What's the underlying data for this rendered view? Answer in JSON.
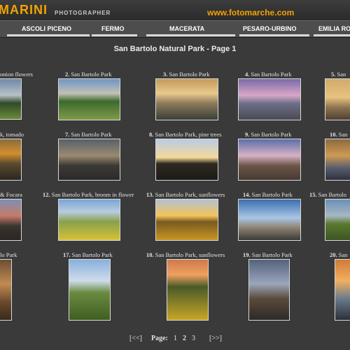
{
  "header": {
    "brand": "MARINI",
    "subtitle": "PHOTOGRAPHER",
    "site_url": "www.fotomarche.com"
  },
  "nav": [
    "ASCOLI PICENO",
    "FERMO",
    "MACERATA",
    "PESARO-URBINO",
    "EMILIA RO"
  ],
  "page_title": "San Bartolo Natural Park - Page 1",
  "gallery": [
    {
      "num": "",
      "label": "onion flowers"
    },
    {
      "num": "2.",
      "label": "San Bartolo Park"
    },
    {
      "num": "3.",
      "label": "San Bartolo Park"
    },
    {
      "num": "4.",
      "label": "San Bartolo Park"
    },
    {
      "num": "5.",
      "label": "San"
    },
    {
      "num": "",
      "label": "k, tomado"
    },
    {
      "num": "7.",
      "label": "San Bartolo Park"
    },
    {
      "num": "8.",
      "label": "San Bartolo Park, pine trees"
    },
    {
      "num": "9.",
      "label": "San Bartolo Park"
    },
    {
      "num": "10.",
      "label": "San"
    },
    {
      "num": "",
      "label": "& Focara"
    },
    {
      "num": "12.",
      "label": "San Bartolo Park, broom in flower"
    },
    {
      "num": "13.",
      "label": "San Bartolo Park, sunflowers"
    },
    {
      "num": "14.",
      "label": "San Bartolo Park"
    },
    {
      "num": "15.",
      "label": "San Bartolo"
    },
    {
      "num": "",
      "label": "lo Park"
    },
    {
      "num": "17.",
      "label": "San Bartolo Park"
    },
    {
      "num": "18.",
      "label": "San Bartolo Park, sunflowers"
    },
    {
      "num": "19.",
      "label": "San Bartolo Park"
    },
    {
      "num": "20.",
      "label": "San"
    }
  ],
  "pager": {
    "prev": "[<<]",
    "label": "Page:",
    "pages": [
      "1",
      "2",
      "3"
    ],
    "next": "[>>]"
  },
  "colors": {
    "accent": "#f3a300",
    "background": "#3a3a3a"
  }
}
